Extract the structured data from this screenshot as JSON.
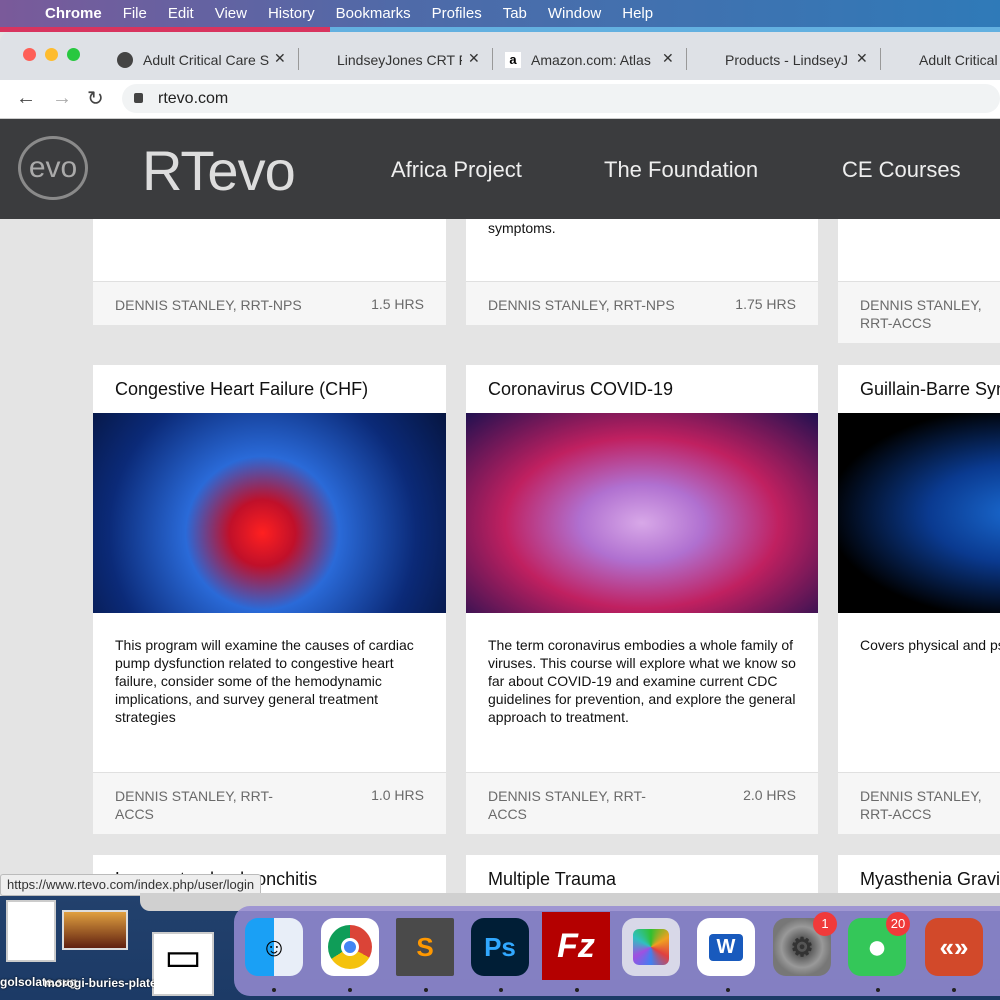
{
  "menubar": {
    "app": "Chrome",
    "items": [
      "File",
      "Edit",
      "View",
      "History",
      "Bookmarks",
      "Profiles",
      "Tab",
      "Window",
      "Help"
    ]
  },
  "tabs": [
    {
      "label": "Adult Critical Care S",
      "icon": "globe-icon"
    },
    {
      "label": "LindseyJones CRT F",
      "icon": ""
    },
    {
      "label": "Amazon.com: Atlas",
      "icon": "amazon-icon"
    },
    {
      "label": "Products - LindseyJ",
      "icon": ""
    },
    {
      "label": "Adult Critical",
      "icon": ""
    }
  ],
  "address": {
    "url": "rtevo.com"
  },
  "site": {
    "logo": "evo",
    "brand": "RTevo",
    "nav": [
      "Africa Project",
      "The Foundation",
      "CE Courses"
    ]
  },
  "row1": [
    {
      "desc_tail": "",
      "author": "DENNIS STANLEY, RRT-NPS",
      "hours": "1.5 HRS"
    },
    {
      "desc_tail": "symptoms.",
      "author": "DENNIS STANLEY, RRT-NPS",
      "hours": "1.75 HRS"
    },
    {
      "desc_tail": "",
      "author": "DENNIS STANLEY, RRT-ACCS",
      "hours": ""
    }
  ],
  "row2": [
    {
      "title": "Congestive Heart Failure (CHF)",
      "desc": "This program will examine the causes of cardiac pump dysfunction related to congestive heart failure, consider some of the hemodynamic implications, and survey general treatment strategies",
      "author": "DENNIS STANLEY, RRT-ACCS",
      "hours": "1.0 HRS"
    },
    {
      "title": "Coronavirus COVID-19",
      "desc": "The term coronavirus embodies a whole family of viruses. This course will explore what we know so far about COVID-19 and examine current CDC guidelines for prevention, and explore the general approach to treatment.",
      "author": "DENNIS STANLEY, RRT-ACCS",
      "hours": "2.0 HRS"
    },
    {
      "title": "Guillain-Barre Syndrome",
      "desc": "Covers physical and psychological aspects, the neurological impact, diagnostic methodologies, and clinical approaches.",
      "author": "DENNIS STANLEY, RRT-ACCS",
      "hours": ""
    }
  ],
  "row3": [
    {
      "title": "Laryngotracheobronchitis"
    },
    {
      "title": "Multiple Trauma"
    },
    {
      "title": "Myasthenia Gravis"
    }
  ],
  "status_url": "https://www.rtevo.com/index.php/user/login",
  "desktop_files": [
    "golsolate.svg",
    "morogi-buries-plates-k...sync.jpg"
  ],
  "dock": [
    {
      "name": "Finder"
    },
    {
      "name": "Chrome"
    },
    {
      "name": "Sublime Text"
    },
    {
      "name": "Photoshop",
      "label": "Ps"
    },
    {
      "name": "FileZilla",
      "label": "Fz"
    },
    {
      "name": "Launchpad"
    },
    {
      "name": "Word",
      "label": "W"
    },
    {
      "name": "System Preferences",
      "badge": "1"
    },
    {
      "name": "Messages",
      "badge": "20"
    },
    {
      "name": "Remote Desktop"
    }
  ]
}
